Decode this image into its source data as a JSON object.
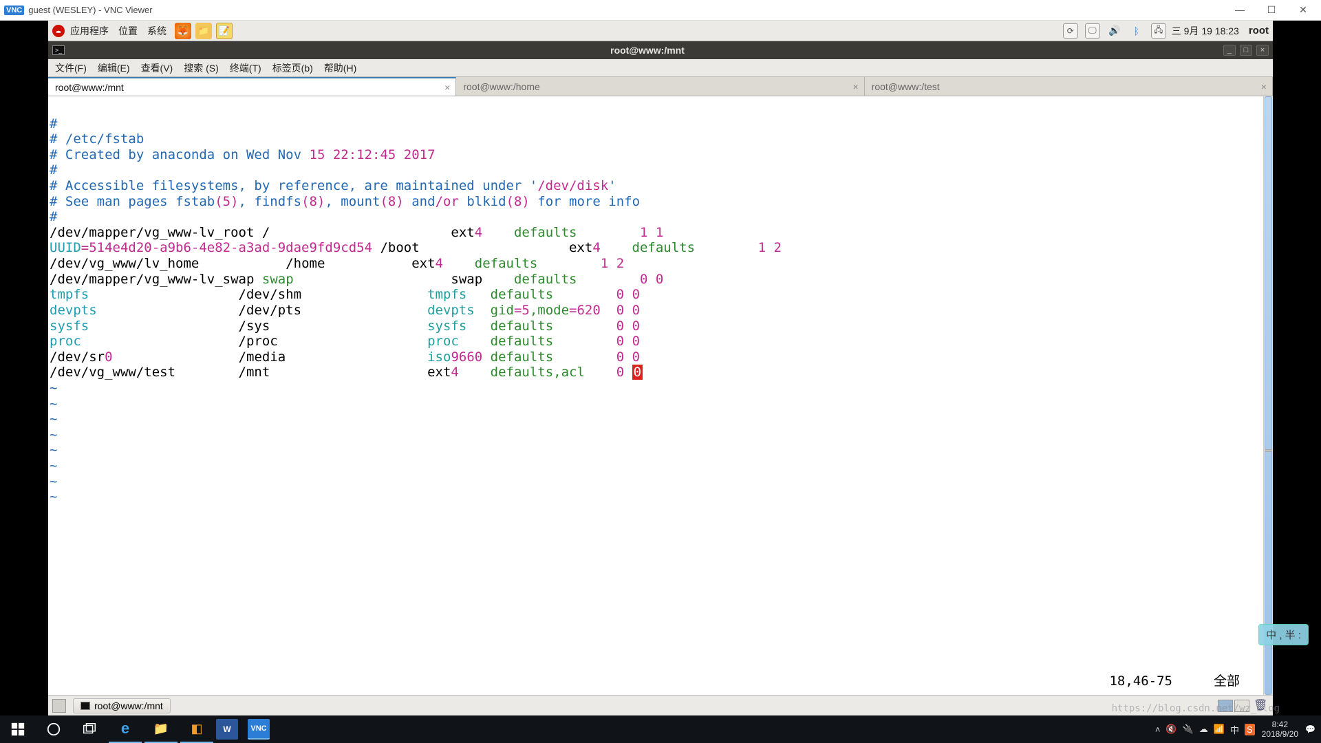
{
  "win": {
    "title": "guest (WESLEY) - VNC Viewer",
    "badge": "VNC"
  },
  "gnome": {
    "menus": [
      "应用程序",
      "位置",
      "系统"
    ],
    "clock": "三 9月 19 18:23",
    "user": "root"
  },
  "term": {
    "title": "root@www:/mnt",
    "menus": [
      "文件(F)",
      "编辑(E)",
      "查看(V)",
      "搜索 (S)",
      "终端(T)",
      "标签页(b)",
      "帮助(H)"
    ],
    "tabs": [
      {
        "label": "root@www:/mnt",
        "active": true
      },
      {
        "label": "root@www:/home",
        "active": false
      },
      {
        "label": "root@www:/test",
        "active": false
      }
    ],
    "vi_pos": "18,46-75",
    "vi_mode": "全部",
    "fstab": {
      "hdr_path": "# /etc/fstab",
      "hdr_created_a": "# Created by anaconda on Wed Nov ",
      "hdr_created_b": "15 22:12:45 2017",
      "hdr_acc_a": "# Accessible filesystems, by reference, are maintained under '",
      "hdr_acc_b": "/dev/disk",
      "hdr_acc_c": "'",
      "hdr_see_a": "# See man pages fstab",
      "hdr_see_p1": "(5)",
      "hdr_see_b": ", findfs",
      "hdr_see_p2": "(8)",
      "hdr_see_c": ", mount",
      "hdr_see_p3": "(8)",
      "hdr_see_d": " and",
      "hdr_see_or": "/or ",
      "hdr_see_e": "blkid",
      "hdr_see_p4": "(8)",
      "hdr_see_f": " for more info",
      "rows": [
        {
          "device": "/dev/mapper/vg_www-lv_root",
          "mount": "/",
          "fs": "ext",
          "fsn": "4",
          "opts": "defaults",
          "d1": "1",
          "d2": "1"
        },
        {
          "device": "UUID",
          "uuid": "=514e4d20-a9b6-4e82-a3ad-9dae9fd9cd54",
          "mount": "/boot",
          "fs": "ext",
          "fsn": "4",
          "opts": "defaults",
          "d1": "1",
          "d2": "2"
        },
        {
          "device": "/dev/vg_www/lv_home",
          "mount": "/home",
          "fs": "ext",
          "fsn": "4",
          "opts": "defaults",
          "d1": "1",
          "d2": "2"
        },
        {
          "device": "/dev/mapper/vg_www-lv_swap",
          "sw": "swap",
          "mount": "swap",
          "fs": "",
          "fsn": "",
          "opts": "defaults",
          "d1": "0",
          "d2": "0"
        },
        {
          "device": "tmpfs",
          "mount": "/dev/shm",
          "fs": "tmpfs",
          "opts": "defaults",
          "d1": "0",
          "d2": "0"
        },
        {
          "device": "devpts",
          "mount": "/dev/pts",
          "fs": "devpts",
          "opts": "gid=5,mode=620",
          "d1": "0",
          "d2": "0"
        },
        {
          "device": "sysfs",
          "mount": "/sys",
          "fs": "sysfs",
          "opts": "defaults",
          "d1": "0",
          "d2": "0"
        },
        {
          "device": "proc",
          "mount": "/proc",
          "fs": "proc",
          "opts": "defaults",
          "d1": "0",
          "d2": "0"
        },
        {
          "device": "/dev/sr",
          "devn": "0",
          "mount": "/media",
          "fs": "iso",
          "fsn": "9660",
          "opts": "defaults",
          "d1": "0",
          "d2": "0"
        },
        {
          "device": "/dev/vg_www/test",
          "mount": "/mnt",
          "fs": "ext",
          "fsn": "4",
          "opts": "defaults",
          "optsx": ",acl",
          "d1": "0",
          "d2": "0",
          "cursor": true
        }
      ]
    }
  },
  "gnome_bottom": {
    "task": "root@www:/mnt"
  },
  "win_taskbar": {
    "time": "8:42",
    "date": "2018/9/20"
  },
  "floater": "中 , 半 :",
  "watermark": "https://blog.csdn.net/wz_blog"
}
